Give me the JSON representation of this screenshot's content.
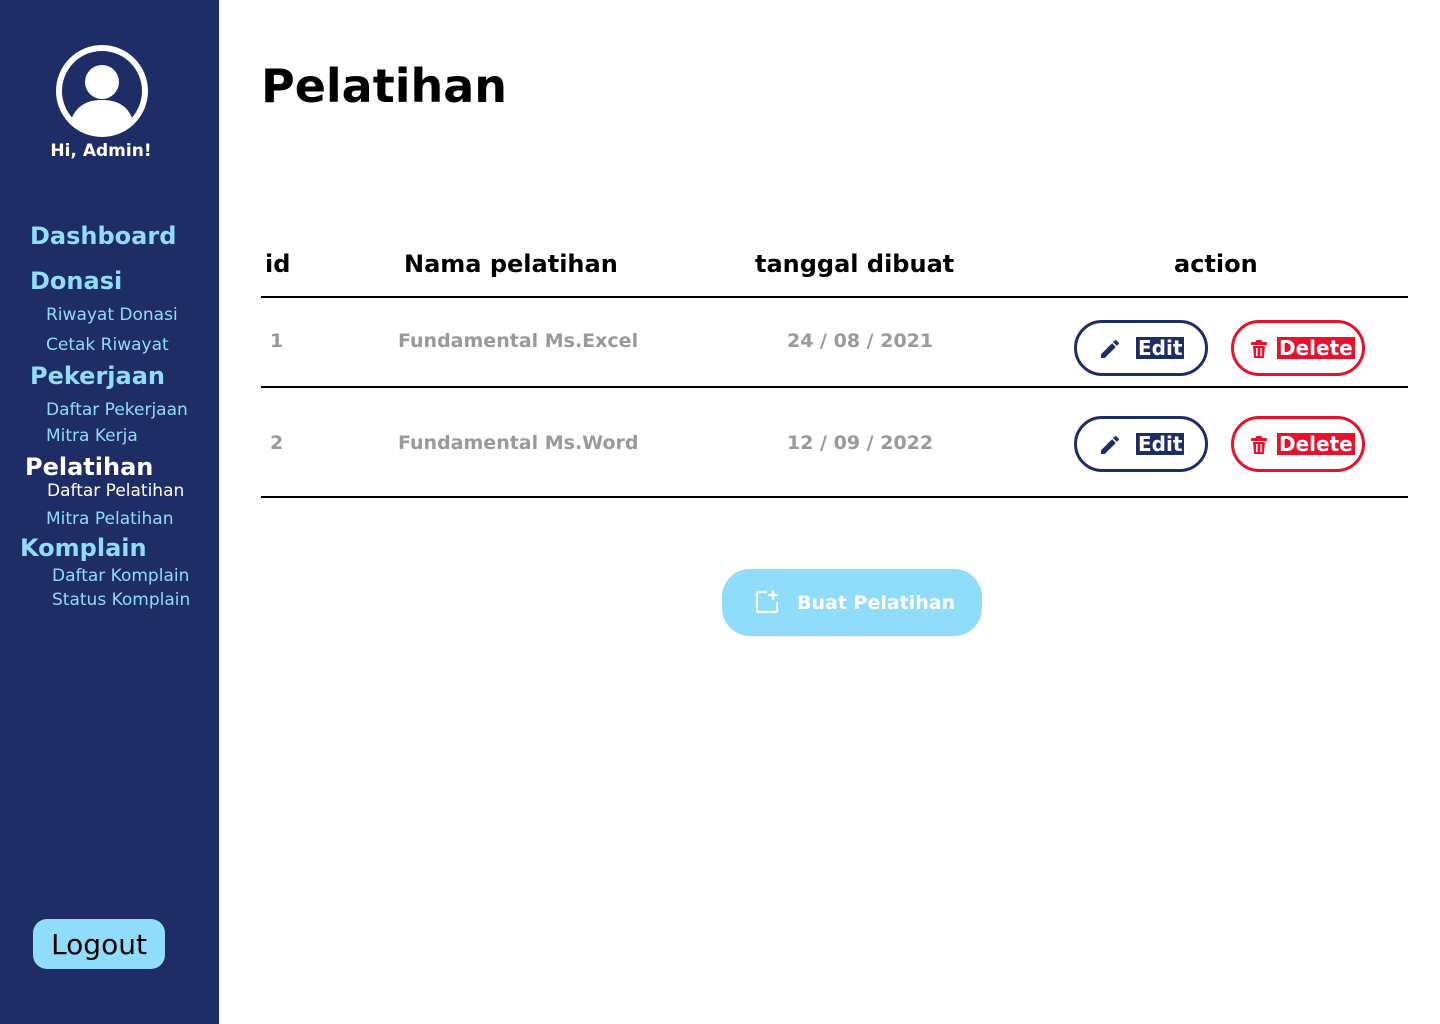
{
  "sidebar": {
    "greeting": "Hi, Admin!",
    "sections": {
      "dashboard": "Dashboard",
      "donasi": "Donasi",
      "riwayat_donasi": "Riwayat Donasi",
      "cetak_riwayat": "Cetak Riwayat",
      "pekerjaan": "Pekerjaan",
      "daftar_pekerjaan": "Daftar Pekerjaan",
      "mitra_kerja": "Mitra Kerja",
      "pelatihan": "Pelatihan",
      "daftar_pelatihan": "Daftar Pelatihan",
      "mitra_pelatihan": "Mitra Pelatihan",
      "komplain": "Komplain",
      "daftar_komplain": "Daftar Komplain",
      "status_komplain": "Status Komplain"
    },
    "logout_label": "Logout"
  },
  "main": {
    "title": "Pelatihan",
    "table": {
      "headers": {
        "id": "id",
        "nama": "Nama pelatihan",
        "tanggal": "tanggal dibuat",
        "action": "action"
      },
      "rows": [
        {
          "id": "1",
          "nama": "Fundamental Ms.Excel",
          "tanggal": "24 / 08 / 2021"
        },
        {
          "id": "2",
          "nama": "Fundamental Ms.Word",
          "tanggal": "12 / 09 / 2022"
        }
      ],
      "edit_label": "Edit",
      "delete_label": "Delete"
    },
    "create_label": "Buat Pelatihan"
  },
  "colors": {
    "sidebar_bg": "#1f2d66",
    "accent": "#8fdcfb",
    "danger": "#e8102a",
    "muted_text": "#9a9a9a"
  },
  "icons": {
    "avatar": "user-circle-icon",
    "edit": "pencil-icon",
    "delete": "trash-icon",
    "create": "add-document-icon"
  }
}
